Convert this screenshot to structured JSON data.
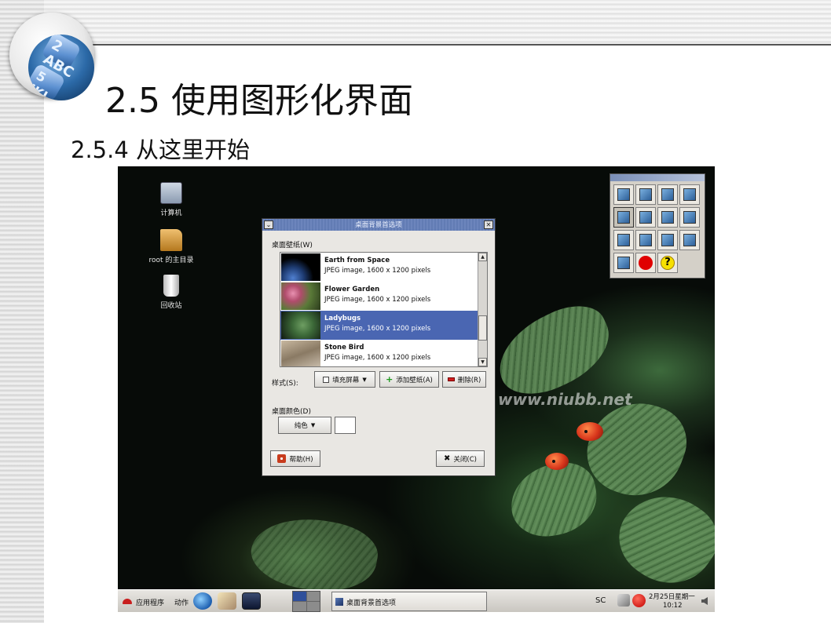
{
  "slide": {
    "title": "2.5 使用图形化界面",
    "subtitle": "2.5.4 从这里开始",
    "logo_keys": [
      "2 ABC",
      "5 JKL"
    ]
  },
  "desktop": {
    "watermark": "www.niubb.net",
    "icons": [
      {
        "label": "计算机",
        "icon": "computer-icon"
      },
      {
        "label": "root 的主目录",
        "icon": "home-folder-icon"
      },
      {
        "label": "回收站",
        "icon": "trash-icon"
      }
    ]
  },
  "dialog": {
    "title": "桌面背景首选项",
    "menu_glyph": "⌄",
    "close_glyph": "✕",
    "wallpaper_label": "桌面壁纸(W)",
    "wallpapers": [
      {
        "name": "Earth from Space",
        "desc": "JPEG image, 1600 x 1200 pixels",
        "selected": false
      },
      {
        "name": "Flower Garden",
        "desc": "JPEG image, 1600 x 1200 pixels",
        "selected": false
      },
      {
        "name": "Ladybugs",
        "desc": "JPEG image, 1600 x 1200 pixels",
        "selected": true
      },
      {
        "name": "Stone Bird",
        "desc": "JPEG image, 1600 x 1200 pixels",
        "selected": false
      }
    ],
    "scroll_up": "▲",
    "scroll_down": "▼",
    "style_label": "样式(S):",
    "style_value": "填充屏幕",
    "caret": "▼",
    "add_button": "添加壁纸(A)",
    "remove_button": "删除(R)",
    "color_label": "桌面颜色(D)",
    "color_value": "纯色",
    "help_button": "帮助(H)",
    "close_button": "关闭(C)"
  },
  "taskbar": {
    "apps_menu": "应用程序",
    "actions_menu": "动作",
    "window_button": "桌面背景首选项",
    "input_method": "SC",
    "date": "2月25日星期一",
    "time": "10:12"
  },
  "colors": {
    "selection": "#4a66b2",
    "titlebar": "#5d78b0",
    "desktop_bg": "#070b08"
  }
}
